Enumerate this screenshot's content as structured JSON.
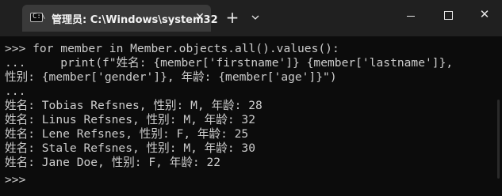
{
  "tab": {
    "title": "管理员: C:\\Windows\\system32",
    "close_label": "✕",
    "icon": "terminal-icon",
    "icon_glyph": "C:\\"
  },
  "toolbar": {
    "new_tab_label": "+",
    "dropdown_icon": "chevron-down-icon"
  },
  "window_controls": {
    "minimize_icon": "minimize-icon",
    "maximize_icon": "maximize-icon",
    "close_icon": "close-icon",
    "close_glyph": "✕"
  },
  "terminal": {
    "lines": [
      ">>> for member in Member.objects.all().values():",
      "...     print(f\"姓名: {member['firstname']} {member['lastname']},",
      "性别: {member['gender']}, 年龄: {member['age']}\")",
      "...",
      "姓名: Tobias Refsnes, 性别: M, 年龄: 28",
      "姓名: Linus Refsnes, 性别: M, 年龄: 32",
      "姓名: Lene Refsnes, 性别: F, 年龄: 25",
      "姓名: Stale Refsnes, 性别: M, 年龄: 30",
      "姓名: Jane Doe, 性别: F, 年龄: 22",
      ">>>"
    ]
  },
  "colors": {
    "background": "#0c0c0c",
    "titlebar": "#202020",
    "active_tab": "#3a3a3a",
    "text": "#cccccc"
  }
}
